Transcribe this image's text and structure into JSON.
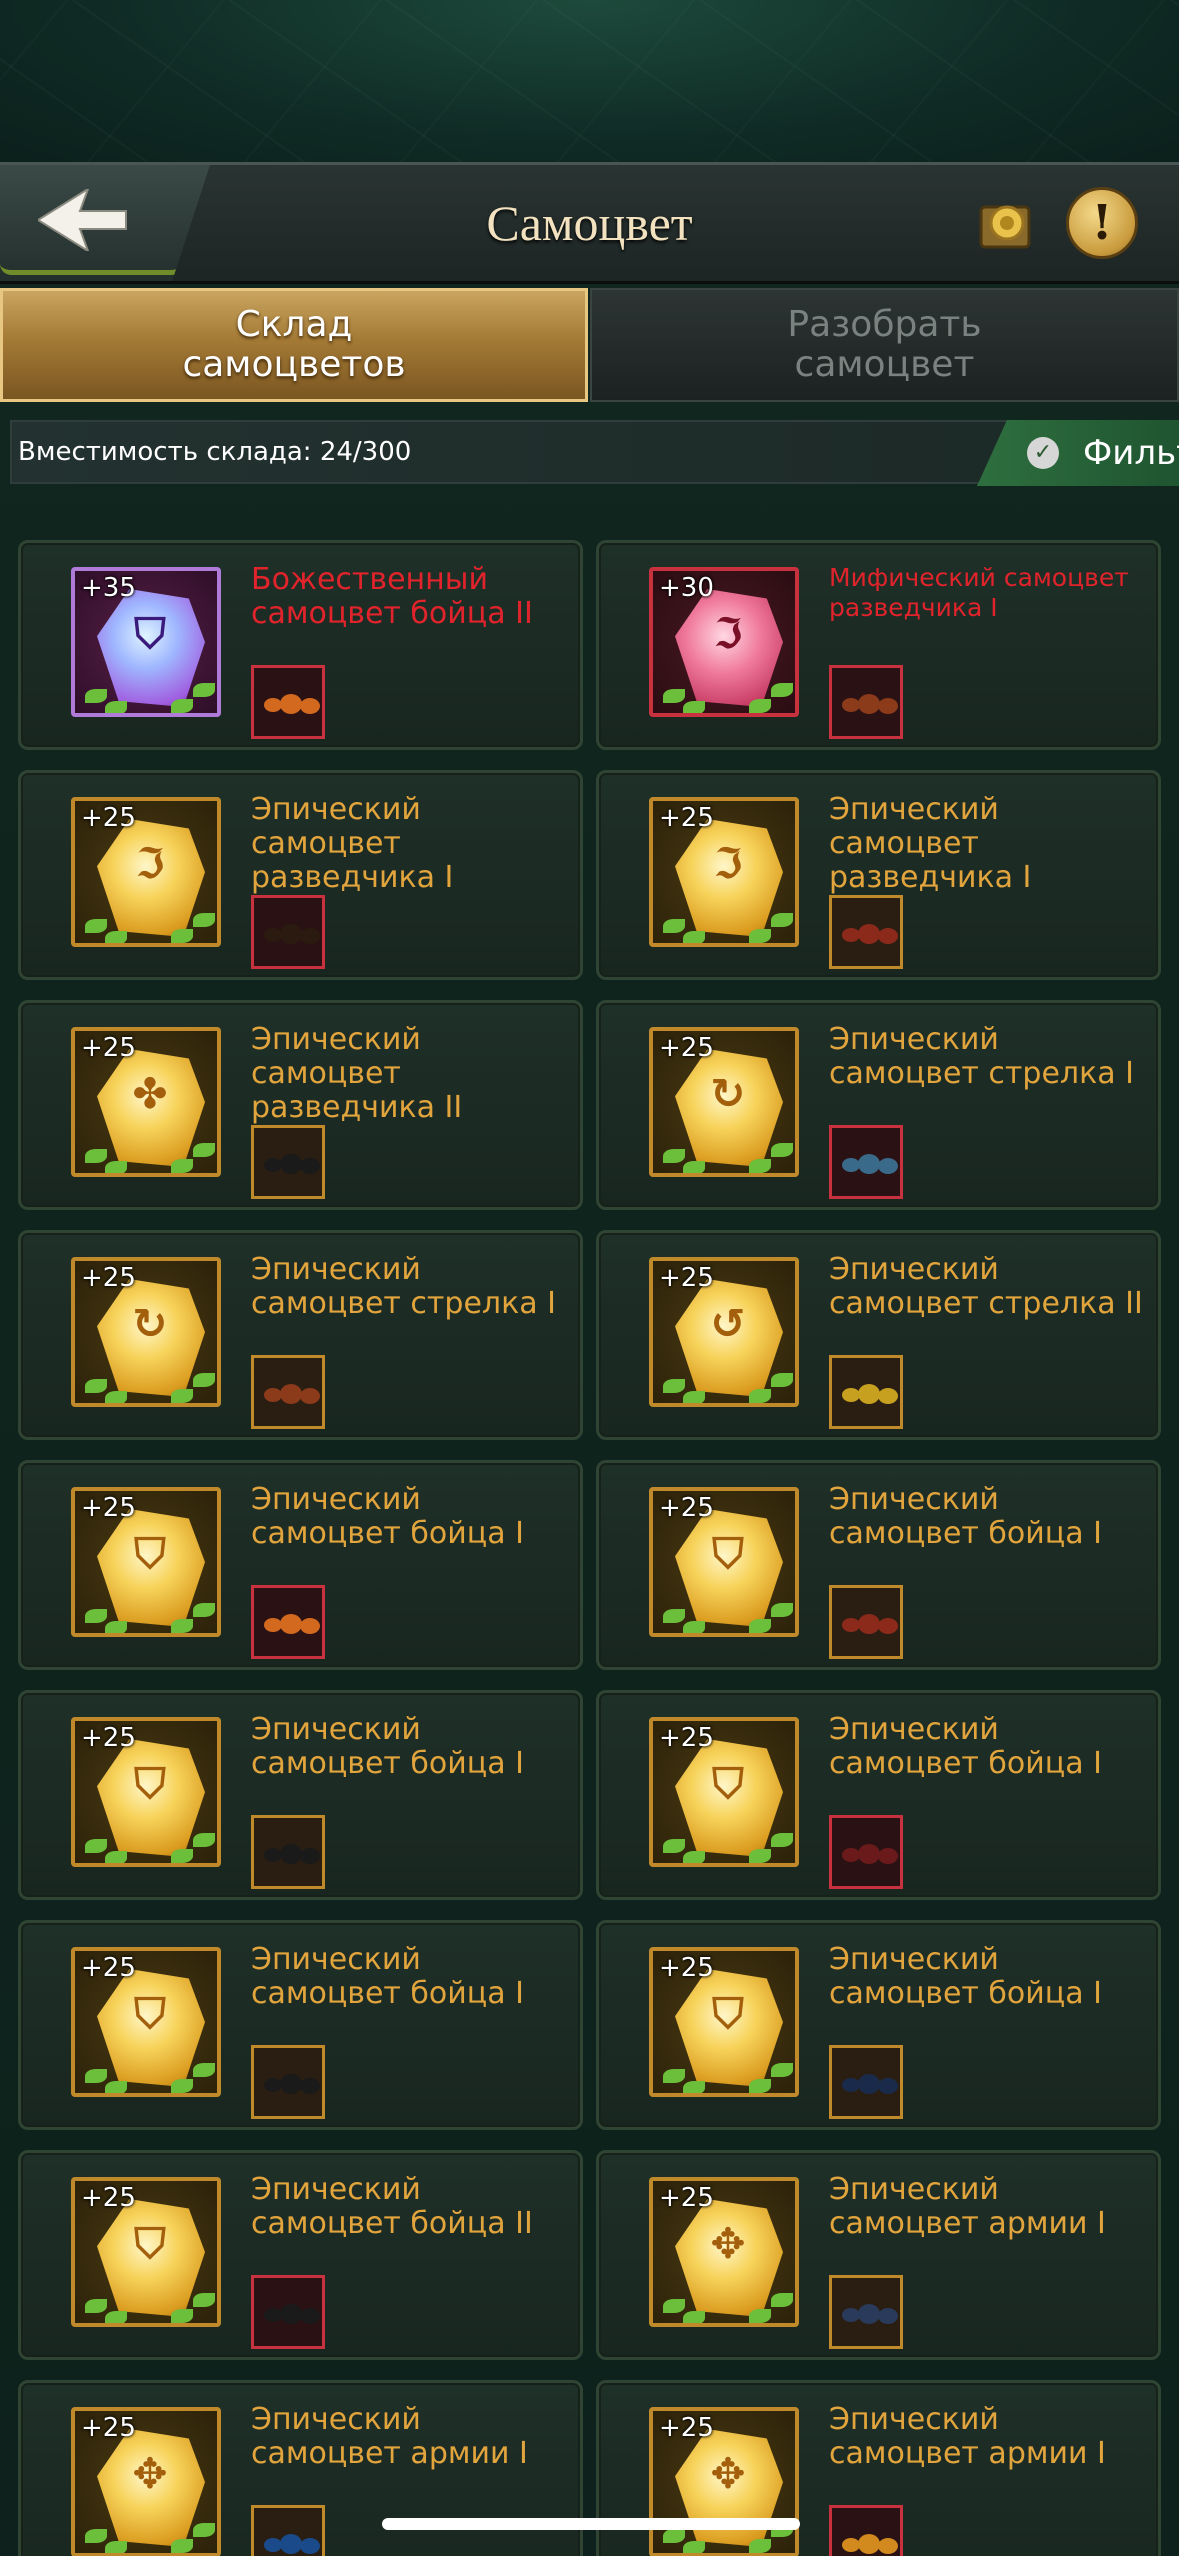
{
  "header": {
    "title": "Самоцвет"
  },
  "tabs": [
    {
      "label_line1": "Склад",
      "label_line2": "самоцветов",
      "active": true
    },
    {
      "label_line1": "Разобрать",
      "label_line2": "самоцвет",
      "active": false
    }
  ],
  "capacity": {
    "text": "Вместимость склада: 24/300"
  },
  "filter": {
    "label": "Фильт"
  },
  "colors": {
    "epic": "#e2a43c",
    "mythic": "#e1232b",
    "divine": "#e1232b",
    "accent": "#c9a560"
  },
  "gems": [
    {
      "level": "+35",
      "name": "Божественный самоцвет бойца II",
      "rarity": "divine",
      "glyph": "⛉",
      "ant_color": "#d2691e"
    },
    {
      "level": "+30",
      "name": "Мифический самоцвет разведчика I",
      "rarity": "mythic",
      "glyph": "ℑ",
      "ant_color": "#8b3a1a"
    },
    {
      "level": "+25",
      "name": "Эпический самоцвет разведчика I",
      "rarity": "epic",
      "glyph": "ℑ",
      "ant_color": "#2a1a10"
    },
    {
      "level": "+25",
      "name": "Эпический самоцвет разведчика I",
      "rarity": "epic",
      "glyph": "ℑ",
      "ant_color": "#8b2a1a"
    },
    {
      "level": "+25",
      "name": "Эпический самоцвет разведчика II",
      "rarity": "epic",
      "glyph": "✤",
      "ant_color": "#1a1a1a"
    },
    {
      "level": "+25",
      "name": "Эпический самоцвет стрелка I",
      "rarity": "epic",
      "glyph": "↻",
      "ant_color": "#3a6a8a"
    },
    {
      "level": "+25",
      "name": "Эпический самоцвет стрелка I",
      "rarity": "epic",
      "glyph": "↻",
      "ant_color": "#8b3a1a"
    },
    {
      "level": "+25",
      "name": "Эпический самоцвет стрелка II",
      "rarity": "epic",
      "glyph": "↺",
      "ant_color": "#c8a020"
    },
    {
      "level": "+25",
      "name": "Эпический самоцвет бойца I",
      "rarity": "epic",
      "glyph": "⛉",
      "ant_color": "#d2691e"
    },
    {
      "level": "+25",
      "name": "Эпический самоцвет бойца I",
      "rarity": "epic",
      "glyph": "⛉",
      "ant_color": "#8b2a1a"
    },
    {
      "level": "+25",
      "name": "Эпический самоцвет бойца I",
      "rarity": "epic",
      "glyph": "⛉",
      "ant_color": "#1a1a1a"
    },
    {
      "level": "+25",
      "name": "Эпический самоцвет бойца I",
      "rarity": "epic",
      "glyph": "⛉",
      "ant_color": "#6a1a1a"
    },
    {
      "level": "+25",
      "name": "Эпический самоцвет бойца I",
      "rarity": "epic",
      "glyph": "⛉",
      "ant_color": "#1a1a1a"
    },
    {
      "level": "+25",
      "name": "Эпический самоцвет бойца I",
      "rarity": "epic",
      "glyph": "⛉",
      "ant_color": "#1a2a4a"
    },
    {
      "level": "+25",
      "name": "Эпический самоцвет бойца II",
      "rarity": "epic",
      "glyph": "⛉",
      "ant_color": "#1a1a1a"
    },
    {
      "level": "+25",
      "name": "Эпический самоцвет армии I",
      "rarity": "epic",
      "glyph": "✥",
      "ant_color": "#2a3a5a"
    },
    {
      "level": "+25",
      "name": "Эпический самоцвет армии I",
      "rarity": "epic",
      "glyph": "✥",
      "ant_color": "#1a4a8a"
    },
    {
      "level": "+25",
      "name": "Эпический самоцвет армии I",
      "rarity": "epic",
      "glyph": "✥",
      "ant_color": "#d2891e"
    }
  ]
}
